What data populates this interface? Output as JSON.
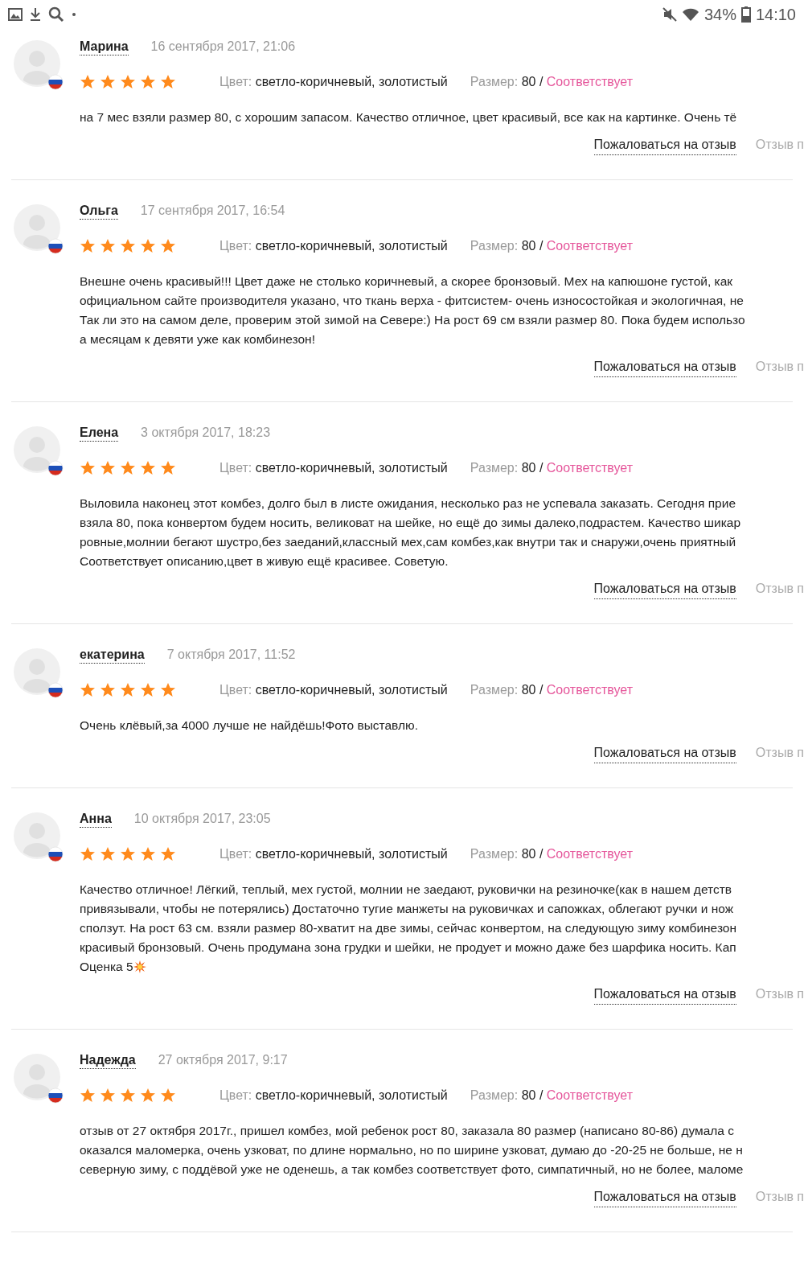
{
  "status_bar": {
    "battery": "34%",
    "time": "14:10"
  },
  "reviews": [
    {
      "author": "Марина",
      "date": "16 сентября 2017, 21:06",
      "stars": 5,
      "color_label": "Цвет:",
      "color_value": "светло-коричневый, золотистый",
      "size_label": "Размер:",
      "size_value": "80 /",
      "fit": "Соответствует",
      "text_lines": [
        "на 7 мес взяли размер 80, с хорошим запасом. Качество отличное, цвет красивый, все как на картинке. Очень тё"
      ],
      "actions": [
        "Пожаловаться на отзыв",
        "Отзыв п"
      ]
    },
    {
      "author": "Ольга",
      "date": "17 сентября 2017, 16:54",
      "stars": 5,
      "color_label": "Цвет:",
      "color_value": "светло-коричневый, золотистый",
      "size_label": "Размер:",
      "size_value": "80 /",
      "fit": "Соответствует",
      "text_lines": [
        "Внешне очень красивый!!! Цвет даже не столько коричневый, а скорее бронзовый. Мех на капюшоне густой, как",
        "официальном сайте производителя указано, что ткань верха - фитсистем- очень износостойкая и экологичная, не",
        "Так ли это на самом деле, проверим этой зимой на Севере:) На рост 69 см взяли размер 80. Пока будем использо",
        "а месяцам к девяти уже как комбинезон!"
      ],
      "actions": [
        "Пожаловаться на отзыв",
        "Отзыв п"
      ]
    },
    {
      "author": "Елена",
      "date": "3 октября 2017, 18:23",
      "stars": 5,
      "color_label": "Цвет:",
      "color_value": "светло-коричневый, золотистый",
      "size_label": "Размер:",
      "size_value": "80 /",
      "fit": "Соответствует",
      "text_lines": [
        "Выловила наконец этот комбез, долго был в листе ожидания, несколько раз не успевала заказать. Сегодня прие",
        "взяла 80, пока конвертом будем носить, великоват на шейке, но ещё до зимы далеко,подрастем. Качество шикар",
        "ровные,молнии бегают шустро,без заеданий,классный мех,сам комбез,как внутри так и снаружи,очень приятный",
        "Соответствует описанию,цвет в живую ещё красивее. Советую."
      ],
      "actions": [
        "Пожаловаться на отзыв",
        "Отзыв п"
      ]
    },
    {
      "author": "екатерина",
      "date": "7 октября 2017, 11:52",
      "stars": 5,
      "color_label": "Цвет:",
      "color_value": "светло-коричневый, золотистый",
      "size_label": "Размер:",
      "size_value": "80 /",
      "fit": "Соответствует",
      "text_lines": [
        "Очень клёвый,за 4000 лучше не найдёшь!Фото выставлю."
      ],
      "actions": [
        "Пожаловаться на отзыв",
        "Отзыв п"
      ]
    },
    {
      "author": "Анна",
      "date": "10 октября 2017, 23:05",
      "stars": 5,
      "color_label": "Цвет:",
      "color_value": "светло-коричневый, золотистый",
      "size_label": "Размер:",
      "size_value": "80 /",
      "fit": "Соответствует",
      "text_lines": [
        "Качество отличное! Лёгкий, теплый, мех густой, молнии не заедают, руковички на резиночке(как в нашем детств",
        "привязывали, чтобы не потерялись) Достаточно тугие манжеты на руковичках и сапожках, облегают ручки и нож",
        "сползут. На рост 63 см. взяли размер 80-хватит на две зимы, сейчас конвертом, на следующую зиму комбинезон",
        "красивый бронзовый. Очень продумана зона грудки и шейки, не продует и можно даже без шарфика носить. Кап",
        "Оценка 5"
      ],
      "actions": [
        "Пожаловаться на отзыв",
        "Отзыв п"
      ]
    },
    {
      "author": "Надежда",
      "date": "27 октября 2017, 9:17",
      "stars": 5,
      "color_label": "Цвет:",
      "color_value": "светло-коричневый, золотистый",
      "size_label": "Размер:",
      "size_value": "80 /",
      "fit": "Соответствует",
      "text_lines": [
        "отзыв от 27 октября 2017г., пришел комбез, мой ребенок рост 80, заказала 80 размер (написано 80-86) думала с",
        "оказался маломерка, очень узковат, по длине нормально, но по ширине узковат, думаю до -20-25 не больше, не н",
        "северную зиму, с поддёвой уже не оденешь, а так комбез соответствует фото, симпатичный, но не более, маломе"
      ],
      "actions": [
        "Пожаловаться на отзыв",
        "Отзыв п"
      ]
    }
  ]
}
